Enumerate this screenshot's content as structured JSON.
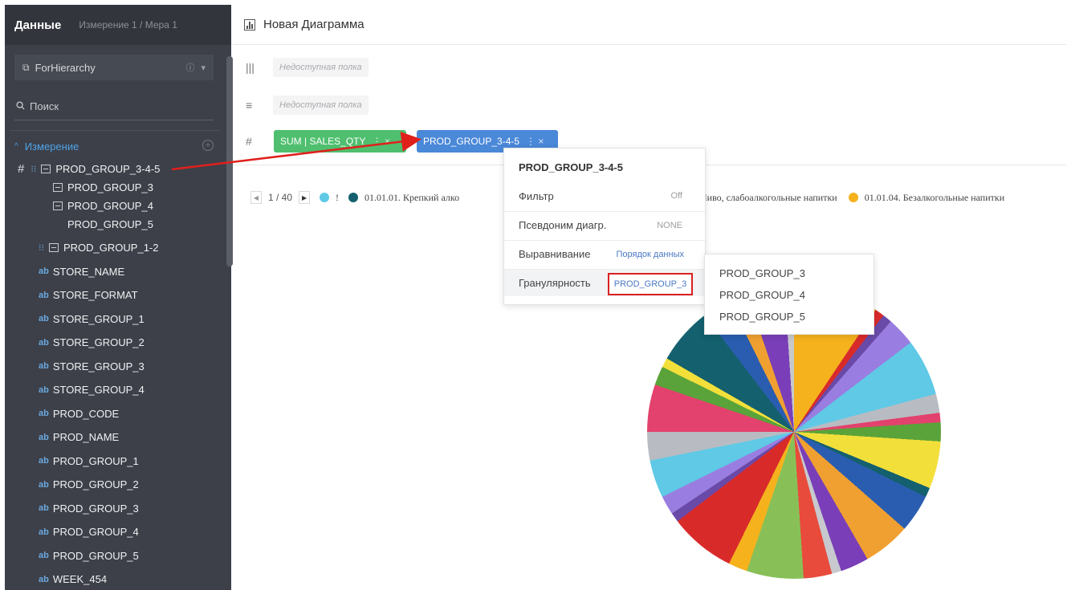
{
  "sidebar": {
    "title": "Данные",
    "subtitle": "Измерение 1 / Мера 1",
    "dataset": "ForHierarchy",
    "search_label": "Поиск",
    "section_label": "Измерение",
    "hierarchy_1": {
      "label": "PROD_GROUP_3-4-5",
      "children": [
        "PROD_GROUP_3",
        "PROD_GROUP_4",
        "PROD_GROUP_5"
      ]
    },
    "hierarchy_2": {
      "label": "PROD_GROUP_1-2"
    },
    "fields": [
      "STORE_NAME",
      "STORE_FORMAT",
      "STORE_GROUP_1",
      "STORE_GROUP_2",
      "STORE_GROUP_3",
      "STORE_GROUP_4",
      "PROD_CODE",
      "PROD_NAME",
      "PROD_GROUP_1",
      "PROD_GROUP_2",
      "PROD_GROUP_3",
      "PROD_GROUP_4",
      "PROD_GROUP_5",
      "WEEK_454"
    ],
    "field_type_badge": "ab"
  },
  "main": {
    "title": "Новая Диаграмма",
    "shelf_placeholder": "Недоступная полка",
    "pill_measure": "SUM | SALES_QTY",
    "pill_dimension": "PROD_GROUP_3-4-5"
  },
  "legend": {
    "pager": "1 / 40",
    "items": [
      {
        "label": "!",
        "color": "#5fc9e6"
      },
      {
        "label": "01.01.01. Крепкий алко",
        "color": "#14606e"
      },
      {
        "label": "Пиво, слабоалкогольные напитки",
        "color": "#2a5db0"
      },
      {
        "label": "01.01.04. Безалкогольные напитки",
        "color": "#f5b21d"
      }
    ]
  },
  "context_menu": {
    "title": "PROD_GROUP_3-4-5",
    "rows": [
      {
        "label": "Фильтр",
        "value": "Off"
      },
      {
        "label": "Псевдоним диагр.",
        "value": "NONE"
      },
      {
        "label": "Выравнивание",
        "value": "Порядок данных"
      },
      {
        "label": "Гранулярность",
        "value": "PROD_GROUP_3"
      }
    ],
    "granularity_options": [
      "PROD_GROUP_3",
      "PROD_GROUP_4",
      "PROD_GROUP_5"
    ]
  },
  "colors": {
    "sidebar_bg": "#3d4049",
    "accent_blue": "#4a88d8",
    "accent_green": "#4fbf6f",
    "highlight_red": "#d92020"
  }
}
